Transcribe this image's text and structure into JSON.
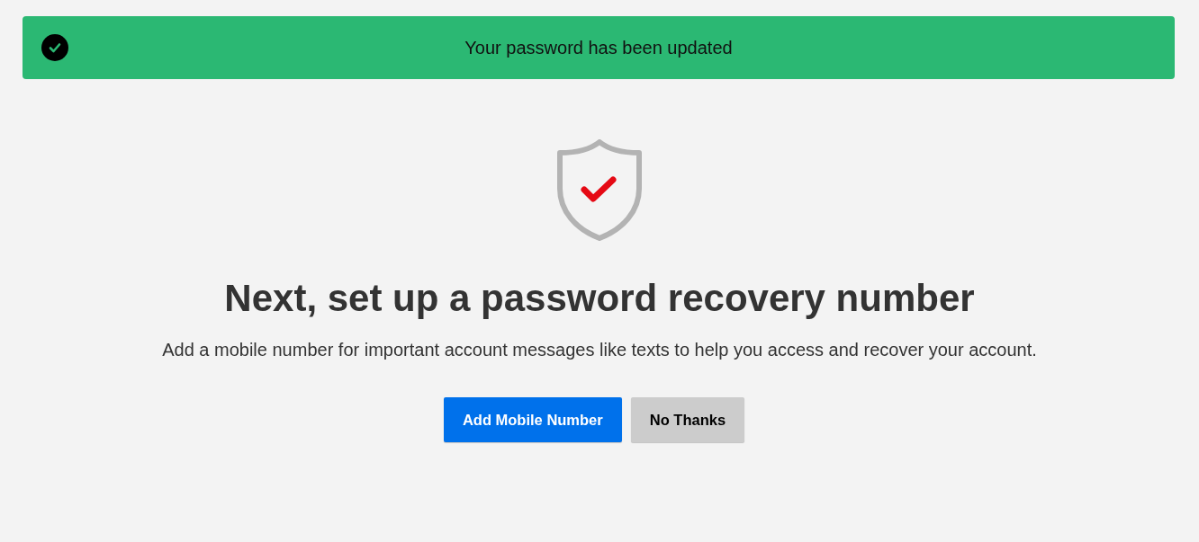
{
  "banner": {
    "kind": "success",
    "message": "Your password has been updated"
  },
  "heading": "Next, set up a password recovery number",
  "description": "Add a mobile number for important account messages like texts to help you access and recover your account.",
  "buttons": [
    {
      "label": "Add Mobile Number",
      "kind": "primary"
    },
    {
      "label": "No Thanks",
      "kind": "secondary"
    }
  ]
}
